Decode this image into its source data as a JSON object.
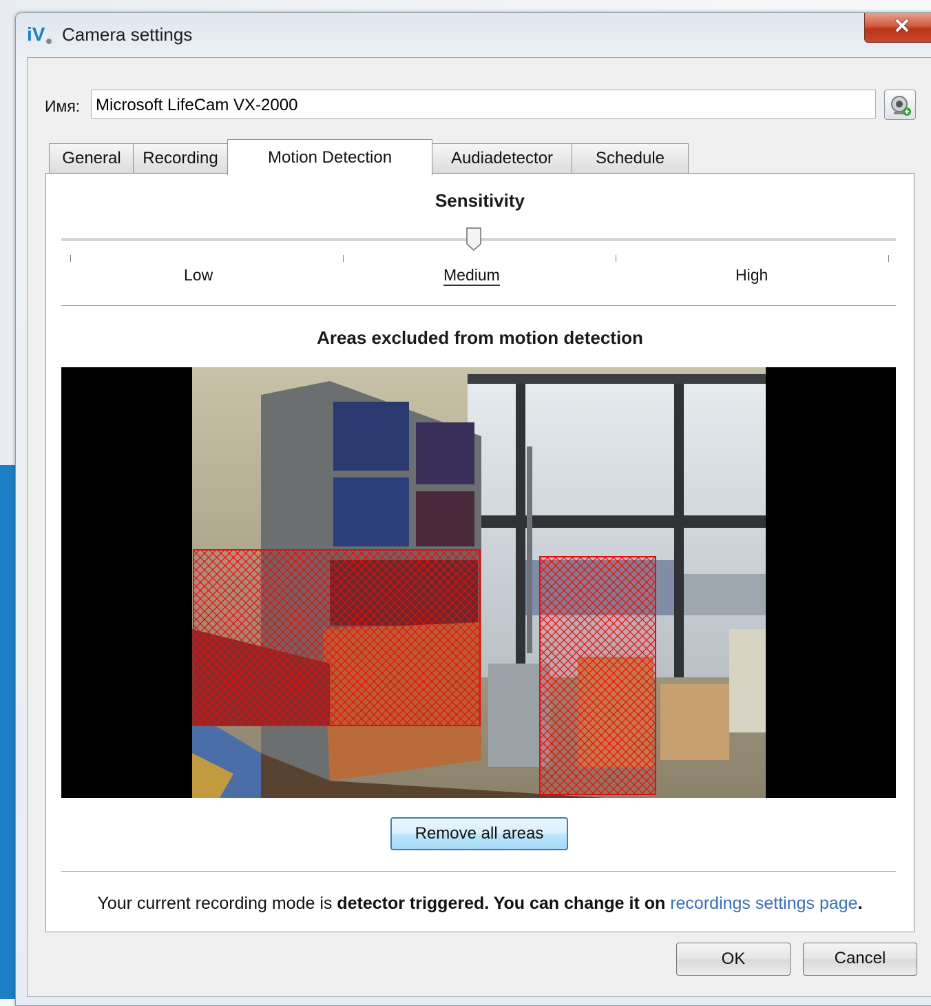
{
  "window": {
    "title": "Camera settings",
    "close_glyph": "✕"
  },
  "name_field": {
    "label": "Имя:",
    "value": "Microsoft LifeCam VX-2000"
  },
  "tabs": [
    {
      "label": "General",
      "active": false
    },
    {
      "label": "Recording",
      "active": false
    },
    {
      "label": "Motion Detection",
      "active": true
    },
    {
      "label": "Audiadetector",
      "active": false
    },
    {
      "label": "Schedule",
      "active": false
    }
  ],
  "sensitivity": {
    "title": "Sensitivity",
    "levels": [
      "Low",
      "Medium",
      "High"
    ],
    "selected": "Medium"
  },
  "excluded_areas": {
    "title": "Areas excluded from motion detection",
    "remove_button": "Remove all areas"
  },
  "info": {
    "part1": "Your current recording mode is ",
    "part2": "detector triggered. You can change it on ",
    "link": "recordings settings page",
    "part3": "."
  },
  "buttons": {
    "ok": "OK",
    "cancel": "Cancel"
  },
  "colors": {
    "link": "#3b6fb6",
    "hatch": "#e01010",
    "accent": "#1c7fc6"
  }
}
